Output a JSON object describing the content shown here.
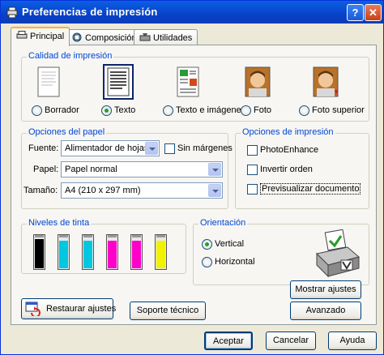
{
  "window": {
    "title": "Preferencias de impresión",
    "help_label": "?",
    "close_label": "✕"
  },
  "tabs": [
    {
      "label": "Principal",
      "icon": "printer-icon",
      "active": true
    },
    {
      "label": "Composición",
      "icon": "layout-icon",
      "active": false
    },
    {
      "label": "Utilidades",
      "icon": "tools-icon",
      "active": false
    }
  ],
  "quality": {
    "title": "Calidad de impresión",
    "options": [
      {
        "label": "Borrador",
        "icon": "draft-page-icon",
        "selected": false
      },
      {
        "label": "Texto",
        "icon": "text-page-icon",
        "selected": true
      },
      {
        "label": "Texto e imágenes",
        "icon": "text-image-page-icon",
        "selected": false
      },
      {
        "label": "Foto",
        "icon": "photo-icon",
        "selected": false
      },
      {
        "label": "Foto superior",
        "icon": "photo-best-icon",
        "selected": false
      }
    ]
  },
  "paper": {
    "title": "Opciones del papel",
    "source_label": "Fuente:",
    "source_value": "Alimentador de hojas",
    "borderless_label": "Sin márgenes",
    "borderless_checked": false,
    "type_label": "Papel:",
    "type_value": "Papel normal",
    "size_label": "Tamaño:",
    "size_value": "A4 (210 x 297 mm)"
  },
  "print_options": {
    "title": "Opciones de impresión",
    "items": [
      {
        "label": "PhotoEnhance",
        "checked": false
      },
      {
        "label": "Invertir orden",
        "checked": false
      },
      {
        "label": "Previsualizar documento",
        "checked": false
      }
    ]
  },
  "ink": {
    "title": "Niveles de tinta",
    "cartridges": [
      {
        "color": "#000000",
        "level": 0.85
      },
      {
        "color": "#00c8e0",
        "level": 0.82
      },
      {
        "color": "#00c8e0",
        "level": 0.8
      },
      {
        "color": "#ff00c8",
        "level": 0.8
      },
      {
        "color": "#ff00c8",
        "level": 0.8
      },
      {
        "color": "#f2f200",
        "level": 0.8
      }
    ]
  },
  "orientation": {
    "title": "Orientación",
    "portrait_label": "Vertical",
    "landscape_label": "Horizontal",
    "selected": "portrait",
    "preview_icon": "printer-orientation-icon"
  },
  "buttons": {
    "show_settings": "Mostrar ajustes",
    "advanced": "Avanzado",
    "restore": "Restaurar ajustes",
    "tech_support": "Soporte técnico",
    "accept": "Aceptar",
    "cancel": "Cancelar",
    "help": "Ayuda"
  },
  "colors": {
    "accent": "#0046d5",
    "title_bar": "#0842c9",
    "radio_selected": "#21a121"
  }
}
